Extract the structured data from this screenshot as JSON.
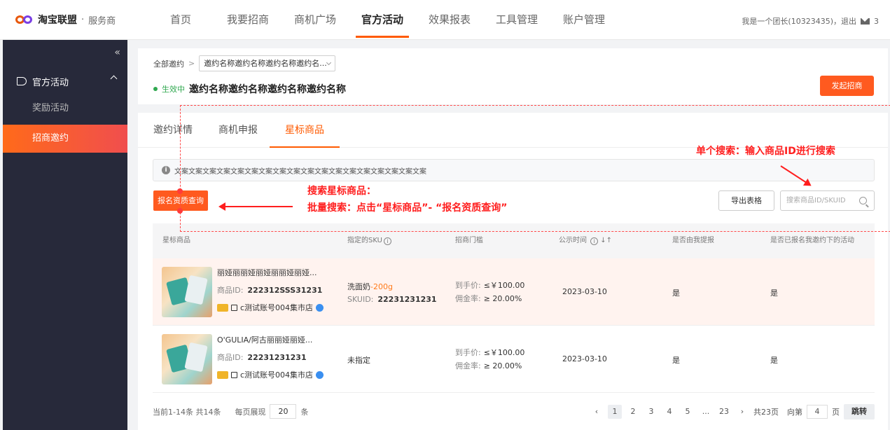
{
  "app": {
    "logo_text": "淘宝联盟",
    "logo_separator": "·",
    "logo_sub": "服务商"
  },
  "nav": [
    "首页",
    "我要招商",
    "商机广场",
    "官方活动",
    "效果报表",
    "工具管理",
    "账户管理"
  ],
  "nav_active": "官方活动",
  "user": {
    "text": "我是一个团长(10323435)，退出",
    "mail_count": "3"
  },
  "sidebar": {
    "collapse_label": "«",
    "group": "官方活动",
    "items": [
      "奖励活动",
      "招商邀约"
    ],
    "active_item": "招商邀约"
  },
  "header": {
    "crumb_root": "全部邀约",
    "crumb_sep": ">",
    "crumb_current": "邀约名称邀约名称邀约名称邀约名...",
    "status": "生效中",
    "title": "邀约名称邀约名称邀约名称邀约名称",
    "start_button": "发起招商"
  },
  "tabs": [
    "邀约详情",
    "商机申报",
    "星标商品"
  ],
  "active_tab": "星标商品",
  "notice": "文案文案文案文案文案文案文案文案文案文案文案文案文案文案文案文案文案文案",
  "toolbar": {
    "qualification_button": "报名资质查询",
    "export_button": "导出表格",
    "search_placeholder": "搜索商品ID/SKUID"
  },
  "table": {
    "columns": [
      "星标商品",
      "指定的SKU",
      "招商门槛",
      "公示时间",
      "是否由我提报",
      "是否已报名我邀约下的活动"
    ],
    "info_glyph": "i",
    "sort_glyph": "↓↑",
    "rows": [
      {
        "name": "丽娅丽丽娅丽娅丽丽娅丽娅...",
        "id_label": "商品ID:",
        "id": "222312SSS31231",
        "shop": "c测试账号004集市店",
        "sku_name": "洗面奶",
        "sku_spec": "-200g",
        "skuid_label": "SKUID:",
        "skuid": "22231231231",
        "threshold_price_label": "到手价:",
        "threshold_price": "≤￥100.00",
        "threshold_comm_label": "佣金率:",
        "threshold_comm": "≥ 20.00%",
        "publish_date": "2023-03-10",
        "by_me": "是",
        "registered": "是"
      },
      {
        "name": "O'GULIA/阿古丽丽娅丽娅...",
        "id_label": "商品ID:",
        "id": "22231231231",
        "shop": "c测试账号004集市店",
        "sku_name": "未指定",
        "threshold_price_label": "到手价:",
        "threshold_price": "≤￥100.00",
        "threshold_comm_label": "佣金率:",
        "threshold_comm": "≥ 20.00%",
        "publish_date": "2023-03-10",
        "by_me": "是",
        "registered": "是"
      }
    ]
  },
  "pagination": {
    "summary": "当前1-14条 共14条",
    "per_page_label": "每页展现",
    "per_page": "20",
    "per_page_unit": "条",
    "prev": "‹",
    "next": "›",
    "pages": [
      "1",
      "2",
      "3",
      "4",
      "5",
      "...",
      "23"
    ],
    "active_page": "1",
    "total": "共23页",
    "goto_label": "向第",
    "goto_value": "4",
    "goto_unit": "页",
    "jump_button": "跳转"
  },
  "annotations": {
    "single_search": "单个搜索：输入商品ID进行搜索",
    "batch_line1": "搜索星标商品：",
    "batch_line2": "批量搜索：点击“星标商品”- “报名资质查询”",
    "color": "#ff1e1e"
  }
}
